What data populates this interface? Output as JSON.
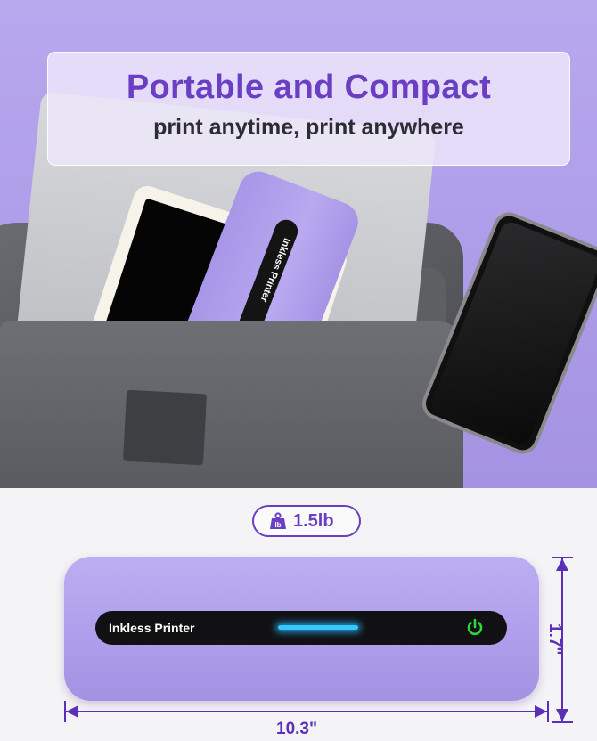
{
  "banner": {
    "title": "Portable and Compact",
    "subtitle": "print anytime, print anywhere"
  },
  "product_label": "Inkless Printer",
  "weight": {
    "icon": "weight-icon",
    "value": "1.5lb"
  },
  "dimensions": {
    "length": "10.3\"",
    "height": "1.7\""
  },
  "colors": {
    "accent": "#6a3fc4",
    "dimension_line": "#5b2fb8",
    "device_body": "#b0a0ec",
    "led": "#38c8ff",
    "power": "#2bd93a"
  }
}
